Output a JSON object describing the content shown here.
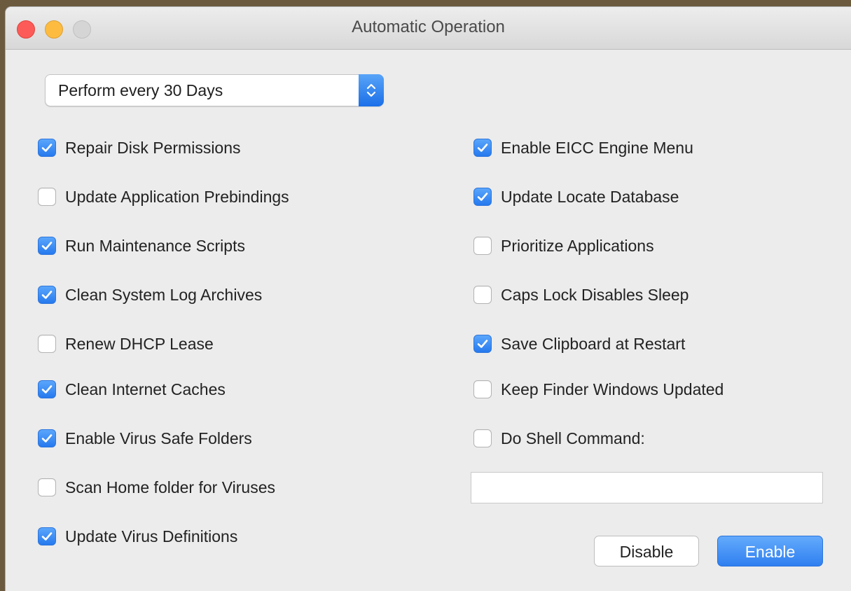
{
  "window": {
    "title": "Automatic Operation"
  },
  "schedule": {
    "selected": "Perform every 30 Days"
  },
  "left_options": [
    {
      "label": "Repair Disk Permissions",
      "checked": true
    },
    {
      "label": "Update Application Prebindings",
      "checked": false
    },
    {
      "label": "Run Maintenance Scripts",
      "checked": true
    },
    {
      "label": "Clean System Log Archives",
      "checked": true
    },
    {
      "label": "Renew DHCP Lease",
      "checked": false
    },
    {
      "label": "Clean Internet Caches",
      "checked": true
    },
    {
      "label": "Enable Virus Safe Folders",
      "checked": true
    },
    {
      "label": "Scan Home folder for Viruses",
      "checked": false
    },
    {
      "label": "Update Virus Definitions",
      "checked": true
    }
  ],
  "right_options": [
    {
      "label": "Enable EICC Engine Menu",
      "checked": true
    },
    {
      "label": "Update Locate Database",
      "checked": true
    },
    {
      "label": "Prioritize Applications",
      "checked": false
    },
    {
      "label": "Caps Lock Disables Sleep",
      "checked": false
    },
    {
      "label": "Save Clipboard at Restart",
      "checked": true
    },
    {
      "label": "Keep Finder Windows Updated",
      "checked": false
    },
    {
      "label": "Do Shell Command:",
      "checked": false
    }
  ],
  "shell_command": {
    "value": ""
  },
  "buttons": {
    "disable": "Disable",
    "enable": "Enable"
  },
  "colors": {
    "accent": "#2f7ff0",
    "close": "#fc5b57",
    "minimize": "#fdbc40"
  },
  "icons": {
    "popup": "chevron-up-down-icon",
    "check": "checkmark-icon"
  }
}
